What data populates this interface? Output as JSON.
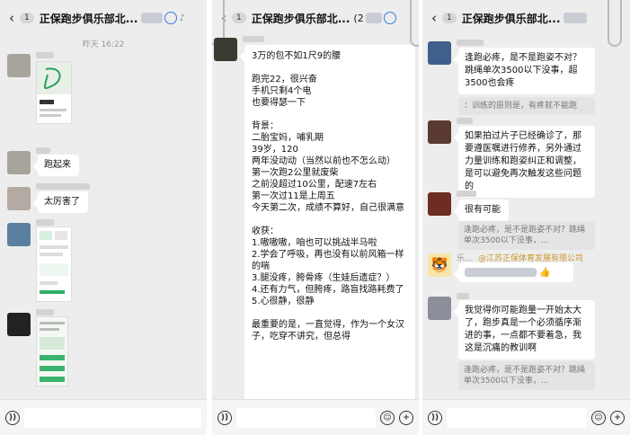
{
  "chat": {
    "back_icon": "chevron-left-icon",
    "title": "正保跑步俱乐部北...",
    "unread_count": "1"
  },
  "panel1": {
    "timestamp": "昨天 16:22",
    "messages": [
      "跑起来",
      "太厉害了"
    ]
  },
  "panel2": {
    "count_suffix": "(2",
    "long_message": "3万的包不如1尺9的腰\n\n跑完22，很兴奋\n手机只剩4个电\n也要得瑟一下\n\n背景：\n二胎宝妈，哺乳期\n39岁，120\n两年没动动（当然以前也不怎么动）\n第一次跑2公里就废柴\n之前没超过10公里，配速7左右\n第一次过11是上周五\n今天第二次，成绩不算好，自己很满意\n\n收获：\n1.嗷嗷嗷，咱也可以挑战半马啦\n2.学会了呼吸，再也没有以前风箱一样的喘\n3.腿没疼，胯骨疼（生娃后遗症？）\n4.还有力气，但胯疼，路盲找路耗费了\n5.心很静，很静\n\n最重要的是，一直觉得，作为一个女汉子，吃穿不讲究，但总得"
  },
  "panel3": {
    "msg1": "逢跑必疼，是不是跑姿不对？跳绳单次3500以下没事，超3500也会疼",
    "quote1": "：训练的原则是，有疼就不能跑",
    "msg2": "如果拍过片子已经确诊了，那要遵医嘱进行修养，另外通过力量训练和跑姿纠正和调整，是可以避免再次触发这些问题的",
    "msg3": "很有可能",
    "quote2": "逢跑必疼，是不是跑姿不对？跳绳单次3500以下没事，...",
    "sender_prefix": "乐...",
    "org_label": "@江苏正保体育发展有限公司",
    "thumbs_up": "👍",
    "msg4": "我觉得你可能跑量一开始太大了，跑步真是一个必须循序渐进的事，一点都不要着急，我这是沉痛的教训啊",
    "quote3": "逢跑必疼，是不是跑姿不对？跳绳单次3500以下没事，..."
  },
  "input_bar": {
    "voice_icon": "voice-icon",
    "emoji_icon": "emoji-icon",
    "plus_icon": "plus-icon"
  },
  "colors": {
    "chat_bg": "#ededed",
    "bubble_bg": "#ffffff",
    "location_icon": "#3c7be3"
  }
}
